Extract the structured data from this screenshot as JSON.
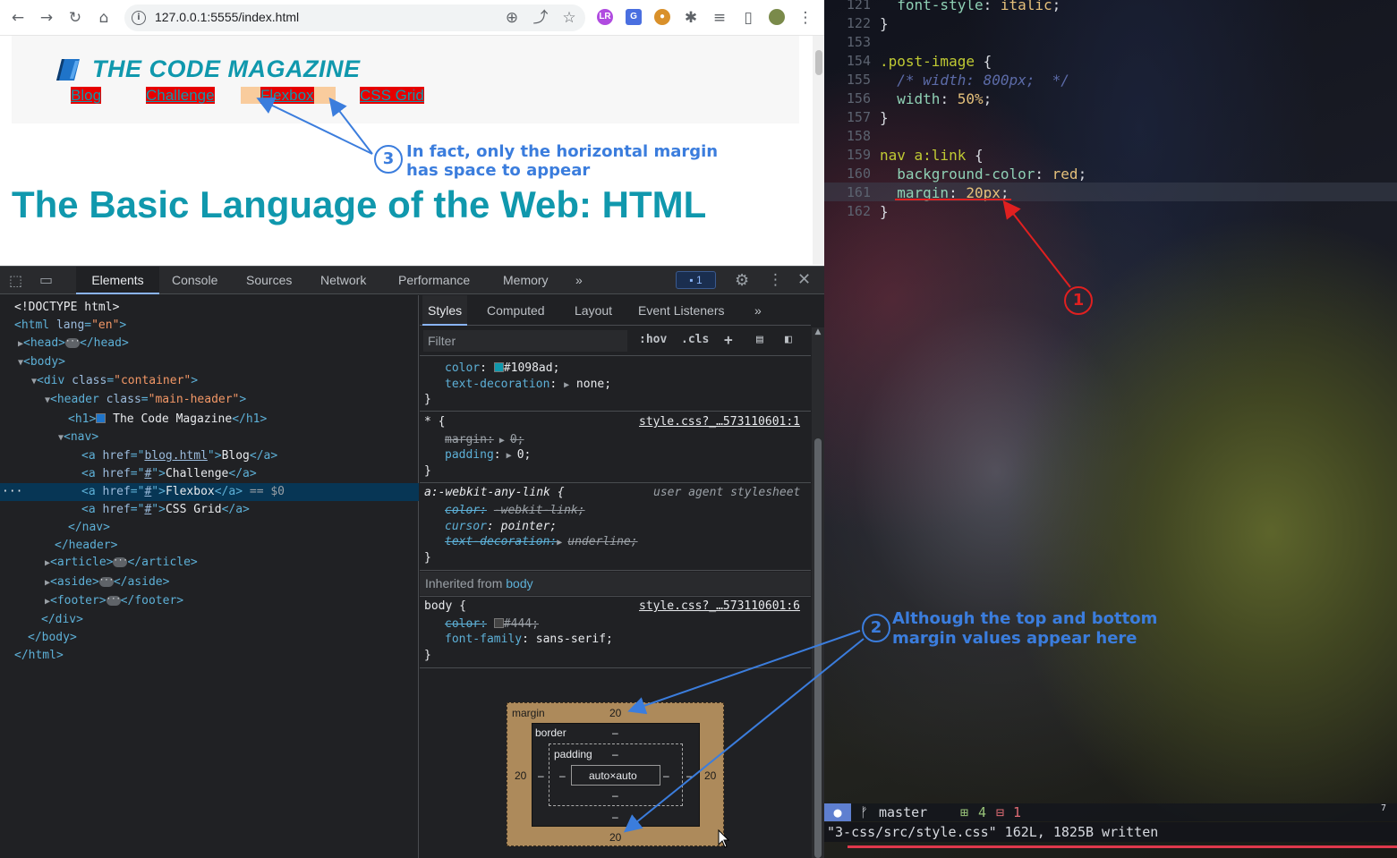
{
  "browser": {
    "url": "127.0.0.1:5555/index.html",
    "extensions": [
      "LR",
      "G",
      "cookie",
      "puzzle",
      "media",
      "sidebar",
      "profile"
    ]
  },
  "site": {
    "title": "THE CODE MAGAZINE",
    "nav": [
      "Blog",
      "Challenge",
      "Flexbox",
      "CSS Grid"
    ],
    "heading": "The Basic Language of the Web: HTML"
  },
  "annotations": {
    "a1_num": "1",
    "a2_num": "2",
    "a2_line1": "Although the top and bottom",
    "a2_line2": "margin values appear here",
    "a3_num": "3",
    "a3_line1": "In fact, only the horizontal margin",
    "a3_line2": "has space to appear",
    "color": "#3b7ddd",
    "editor_color": "#e02020"
  },
  "devtools": {
    "tabs": [
      "Elements",
      "Console",
      "Sources",
      "Network",
      "Performance",
      "Memory"
    ],
    "more": "»",
    "issues_count": "1",
    "dom": {
      "doctype": "<!DOCTYPE html>",
      "html_open": "<html lang=\"en\">",
      "selected_marker": "== $0",
      "h1_text": "The Code Magazine",
      "links": [
        {
          "href": "blog.html",
          "text": "Blog"
        },
        {
          "href": "#",
          "text": "Challenge"
        },
        {
          "href": "#",
          "text": "Flexbox"
        },
        {
          "href": "#",
          "text": "CSS Grid"
        }
      ]
    },
    "styles": {
      "subtabs": [
        "Styles",
        "Computed",
        "Layout",
        "Event Listeners"
      ],
      "filter_placeholder": "Filter",
      "hov": ":hov",
      "cls": ".cls",
      "rule0_color": "#1098ad",
      "rule0_textdecoration": "none",
      "rule1_selector": "* {",
      "rule1_source": "style.css?_…573110601:1",
      "rule1_margin": "0;",
      "rule1_padding": "0;",
      "rule2_selector": "a:-webkit-any-link {",
      "rule2_source": "user agent stylesheet",
      "rule2_color": "-webkit-link;",
      "rule2_cursor": "pointer;",
      "rule2_textdecoration": "underline;",
      "inherited_label": "Inherited from",
      "inherited_from": "body",
      "rule3_selector": "body {",
      "rule3_source": "style.css?_…573110601:6",
      "rule3_color": "#444;",
      "rule3_fontfamily": "sans-serif;"
    },
    "boxmodel": {
      "margin_label": "margin",
      "border_label": "border",
      "padding_label": "padding",
      "margin_top": "20",
      "margin_bottom": "20",
      "margin_left": "20",
      "margin_right": "20",
      "border_value": "–",
      "padding_value": "–",
      "content": "auto×auto"
    }
  },
  "editor": {
    "lines": [
      {
        "num": "121",
        "code": "  font-style: italic;"
      },
      {
        "num": "122",
        "code": "}"
      },
      {
        "num": "153",
        "code": ""
      },
      {
        "num": "154",
        "code": ".post-image {"
      },
      {
        "num": "155",
        "code": "  /* width: 800px;  */"
      },
      {
        "num": "156",
        "code": "  width: 50%;"
      },
      {
        "num": "157",
        "code": "}"
      },
      {
        "num": "158",
        "code": ""
      },
      {
        "num": "159",
        "code": "nav a:link {"
      },
      {
        "num": "160",
        "code": "  background-color: red;"
      },
      {
        "num": "161",
        "code": "  margin: 20px;"
      },
      {
        "num": "162",
        "code": "}"
      }
    ],
    "status": {
      "mode": "●",
      "branch": "master",
      "added": "4",
      "removed": "1",
      "right": "7"
    },
    "message": "\"3-css/src/style.css\" 162L, 1825B written"
  }
}
